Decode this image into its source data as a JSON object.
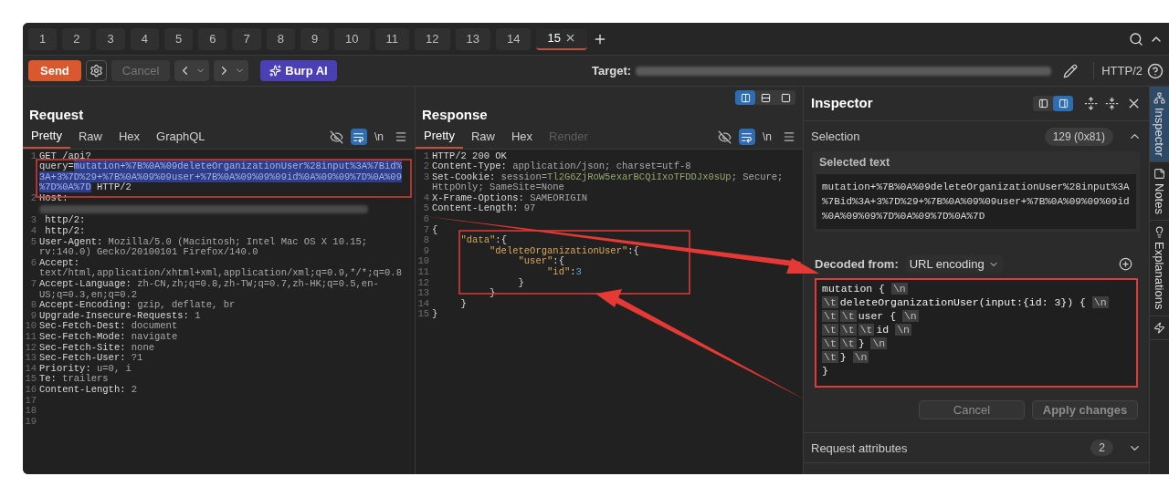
{
  "tabs": [
    {
      "label": "1",
      "selected": false
    },
    {
      "label": "2",
      "selected": false
    },
    {
      "label": "3",
      "selected": false
    },
    {
      "label": "4",
      "selected": false
    },
    {
      "label": "5",
      "selected": false
    },
    {
      "label": "6",
      "selected": false
    },
    {
      "label": "7",
      "selected": false
    },
    {
      "label": "8",
      "selected": false
    },
    {
      "label": "9",
      "selected": false
    },
    {
      "label": "10",
      "selected": false
    },
    {
      "label": "11",
      "selected": false
    },
    {
      "label": "12",
      "selected": false
    },
    {
      "label": "13",
      "selected": false
    },
    {
      "label": "14",
      "selected": false
    },
    {
      "label": "15",
      "selected": true
    }
  ],
  "toolbar": {
    "send": "Send",
    "cancel": "Cancel",
    "burp_ai": "Burp AI",
    "target_label": "Target:",
    "protocol": "HTTP/2"
  },
  "request": {
    "title": "Request",
    "view_tabs": [
      {
        "label": "Pretty",
        "selected": true
      },
      {
        "label": "Raw",
        "selected": false
      },
      {
        "label": "Hex",
        "selected": false
      },
      {
        "label": "GraphQL",
        "selected": false
      }
    ],
    "newline_toggle": "\\n",
    "lines": [
      {
        "num": "1",
        "parts": [
          {
            "kind": "plain",
            "text": "GET /api?query="
          },
          {
            "kind": "selected",
            "text": "mutation+%7B%0A%09deleteOrganizationUser%28input%3A%7Bid%3A+3%7D%29+%7B%0A%09%09user+%7B%0A%09%09%09id%0A%09%09%7D%0A%09%7D%0A%7D"
          },
          {
            "kind": "plain",
            "text": " HTTP/2"
          }
        ]
      },
      {
        "num": "2",
        "parts": [
          {
            "kind": "name",
            "text": "Host:"
          },
          {
            "kind": "redacted"
          }
        ]
      },
      {
        "num": "3",
        "parts": [
          {
            "kind": "plain",
            "text": " http/2:"
          }
        ]
      },
      {
        "num": "4",
        "parts": [
          {
            "kind": "plain",
            "text": " http/2:"
          }
        ]
      },
      {
        "num": "5",
        "parts": [
          {
            "kind": "name",
            "text": "User-Agent:"
          },
          {
            "kind": "value",
            "text": " Mozilla/5.0 (Macintosh; Intel Mac OS X 10.15; rv:140.0) Gecko/20100101 Firefox/140.0"
          }
        ]
      },
      {
        "num": "6",
        "parts": [
          {
            "kind": "name",
            "text": "Accept:"
          },
          {
            "kind": "value",
            "text": " text/html,application/xhtml+xml,application/xml;q=0.9,*/*;q=0.8"
          }
        ]
      },
      {
        "num": "7",
        "parts": [
          {
            "kind": "name",
            "text": "Accept-Language:"
          },
          {
            "kind": "value",
            "text": " zh-CN,zh;q=0.8,zh-TW;q=0.7,zh-HK;q=0.5,en-US;q=0.3,en;q=0.2"
          }
        ]
      },
      {
        "num": "8",
        "parts": [
          {
            "kind": "name",
            "text": "Accept-Encoding:"
          },
          {
            "kind": "value",
            "text": " gzip, deflate, br"
          }
        ]
      },
      {
        "num": "9",
        "parts": [
          {
            "kind": "name",
            "text": "Upgrade-Insecure-Requests:"
          },
          {
            "kind": "value",
            "text": " 1"
          }
        ]
      },
      {
        "num": "10",
        "parts": [
          {
            "kind": "name",
            "text": "Sec-Fetch-Dest:"
          },
          {
            "kind": "value",
            "text": " document"
          }
        ]
      },
      {
        "num": "11",
        "parts": [
          {
            "kind": "name",
            "text": "Sec-Fetch-Mode:"
          },
          {
            "kind": "value",
            "text": " navigate"
          }
        ]
      },
      {
        "num": "12",
        "parts": [
          {
            "kind": "name",
            "text": "Sec-Fetch-Site:"
          },
          {
            "kind": "value",
            "text": " none"
          }
        ]
      },
      {
        "num": "13",
        "parts": [
          {
            "kind": "name",
            "text": "Sec-Fetch-User:"
          },
          {
            "kind": "value",
            "text": " ?1"
          }
        ]
      },
      {
        "num": "14",
        "parts": [
          {
            "kind": "name",
            "text": "Priority:"
          },
          {
            "kind": "value",
            "text": " u=0, i"
          }
        ]
      },
      {
        "num": "15",
        "parts": [
          {
            "kind": "name",
            "text": "Te:"
          },
          {
            "kind": "value",
            "text": " trailers"
          }
        ]
      },
      {
        "num": "16",
        "parts": [
          {
            "kind": "name",
            "text": "Content-Length:"
          },
          {
            "kind": "value",
            "text": " 2"
          }
        ]
      },
      {
        "num": "17"
      },
      {
        "num": "18"
      },
      {
        "num": "19"
      }
    ]
  },
  "response": {
    "title": "Response",
    "layout_buttons": [
      {
        "selected": true
      },
      {
        "selected": false
      },
      {
        "selected": false
      }
    ],
    "view_tabs": [
      {
        "label": "Pretty",
        "selected": true,
        "disabled": false
      },
      {
        "label": "Raw",
        "selected": false,
        "disabled": false
      },
      {
        "label": "Hex",
        "selected": false,
        "disabled": false
      },
      {
        "label": "Render",
        "selected": false,
        "disabled": true
      }
    ],
    "newline_toggle": "\\n",
    "lines": [
      {
        "num": "1",
        "parts": [
          {
            "kind": "name",
            "text": "HTTP/2 200 OK"
          }
        ]
      },
      {
        "num": "2",
        "parts": [
          {
            "kind": "name",
            "text": "Content-Type:"
          },
          {
            "kind": "value",
            "text": " application/json; charset=utf-8"
          }
        ]
      },
      {
        "num": "3",
        "parts": [
          {
            "kind": "name",
            "text": "Set-Cookie:"
          },
          {
            "kind": "value",
            "text": " session="
          },
          {
            "kind": "string",
            "text": "Tl2G6ZjRoW5exarBCQiIxoTFDDJx0sUp"
          },
          {
            "kind": "value",
            "text": "; Secure; HttpOnly; SameSite=None"
          }
        ]
      },
      {
        "num": "4",
        "parts": [
          {
            "kind": "name",
            "text": "X-Frame-Options:"
          },
          {
            "kind": "value",
            "text": " SAMEORIGIN"
          }
        ]
      },
      {
        "num": "5",
        "parts": [
          {
            "kind": "name",
            "text": "Content-Length:"
          },
          {
            "kind": "value",
            "text": " 97"
          }
        ]
      },
      {
        "num": "6"
      },
      {
        "num": "7",
        "parts": [
          {
            "kind": "plain",
            "text": "{"
          }
        ]
      },
      {
        "num": "8",
        "parts": [
          {
            "kind": "key",
            "text": "     \"data\""
          },
          {
            "kind": "plain",
            "text": ":{"
          }
        ]
      },
      {
        "num": "9",
        "parts": [
          {
            "kind": "key",
            "text": "          \"deleteOrganizationUser\""
          },
          {
            "kind": "plain",
            "text": ":{"
          }
        ]
      },
      {
        "num": "10",
        "parts": [
          {
            "kind": "key",
            "text": "               \"user\""
          },
          {
            "kind": "plain",
            "text": ":{"
          }
        ]
      },
      {
        "num": "11",
        "parts": [
          {
            "kind": "key",
            "text": "                    \"id\""
          },
          {
            "kind": "plain",
            "text": ":"
          },
          {
            "kind": "number",
            "text": "3"
          }
        ]
      },
      {
        "num": "12",
        "parts": [
          {
            "kind": "plain",
            "text": "               }"
          }
        ]
      },
      {
        "num": "13",
        "parts": [
          {
            "kind": "plain",
            "text": "          }"
          }
        ]
      },
      {
        "num": "14",
        "parts": [
          {
            "kind": "plain",
            "text": "     }"
          }
        ]
      },
      {
        "num": "15",
        "parts": [
          {
            "kind": "plain",
            "text": "}"
          }
        ]
      }
    ]
  },
  "inspector": {
    "title": "Inspector",
    "layout_buttons": [
      {
        "selected": false
      },
      {
        "selected": true
      }
    ],
    "selection_label": "Selection",
    "selection_count": "129 (0x81)",
    "selected_text_label": "Selected text",
    "selected_text": "mutation+%7B%0A%09deleteOrganizationUser%28input%3A%7Bid%3A+3%7D%29+%7B%0A%09%09user+%7B%0A%09%09%09id%0A%09%09%7D%0A%09%7D%0A%7D",
    "decoded_label": "Decoded from:",
    "decoded_encoding": "URL encoding",
    "decoded_lines": [
      [
        {
          "kind": "text",
          "text": "mutation { "
        },
        {
          "kind": "escape",
          "text": "\\n"
        }
      ],
      [
        {
          "kind": "escape",
          "text": "\\t"
        },
        {
          "kind": "text",
          "text": "deleteOrganizationUser(input:{id: 3}) { "
        },
        {
          "kind": "escape",
          "text": "\\n"
        }
      ],
      [
        {
          "kind": "escape",
          "text": "\\t"
        },
        {
          "kind": "escape",
          "text": "\\t"
        },
        {
          "kind": "text",
          "text": "user { "
        },
        {
          "kind": "escape",
          "text": "\\n"
        }
      ],
      [
        {
          "kind": "escape",
          "text": "\\t"
        },
        {
          "kind": "escape",
          "text": "\\t"
        },
        {
          "kind": "escape",
          "text": "\\t"
        },
        {
          "kind": "text",
          "text": "id "
        },
        {
          "kind": "escape",
          "text": "\\n"
        }
      ],
      [
        {
          "kind": "escape",
          "text": "\\t"
        },
        {
          "kind": "escape",
          "text": "\\t"
        },
        {
          "kind": "text",
          "text": "} "
        },
        {
          "kind": "escape",
          "text": "\\n"
        }
      ],
      [
        {
          "kind": "escape",
          "text": "\\t"
        },
        {
          "kind": "text",
          "text": "} "
        },
        {
          "kind": "escape",
          "text": "\\n"
        }
      ],
      [
        {
          "kind": "text",
          "text": "}"
        }
      ]
    ],
    "cancel": "Cancel",
    "apply": "Apply changes",
    "request_attributes": "Request attributes",
    "request_attributes_count": "2"
  },
  "side_tabs": [
    {
      "label": "Inspector",
      "selected": true,
      "kind": "inspector"
    },
    {
      "label": "Notes",
      "selected": false,
      "kind": "notes"
    },
    {
      "label": "Explanations",
      "selected": false,
      "kind": "explanations"
    },
    {
      "selected": false,
      "kind": "bolt"
    }
  ]
}
